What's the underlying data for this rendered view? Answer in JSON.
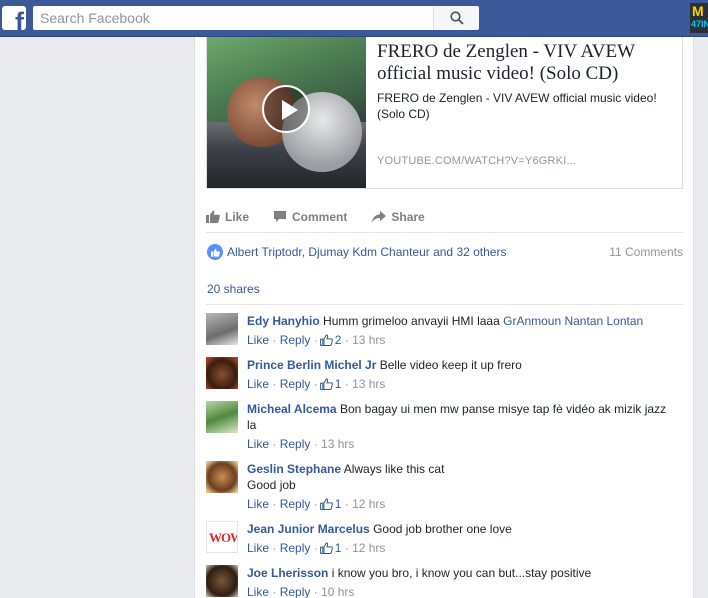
{
  "topbar": {
    "logo_letter": "f",
    "search_placeholder": "Search Facebook",
    "badge_text": "M",
    "badge_subtext": "47IN"
  },
  "link_preview": {
    "title": "FRERO de Zenglen - VIV AVEW official music video! (Solo CD)",
    "description": "FRERO de Zenglen - VIV AVEW official music video! (Solo CD)",
    "domain": "YOUTUBE.COM/WATCH?V=Y6GRKI..."
  },
  "actions": {
    "like": "Like",
    "comment": "Comment",
    "share": "Share"
  },
  "reactions": {
    "names": "Albert Triptodr, Djumay Kdm Chanteur and 32 others",
    "comments_count": "11 Comments"
  },
  "shares": "20 shares",
  "comments": [
    {
      "name": "Edy Hanyhio",
      "text": "Humm grimeloo anvayii HMI laaa",
      "mention": "GrAnmoun Nantan Lontan",
      "like": "Like",
      "reply": "Reply",
      "likes": "2",
      "time": "13 hrs"
    },
    {
      "name": "Prince Berlin Michel Jr",
      "text": "Belle video keep it up frero",
      "like": "Like",
      "reply": "Reply",
      "likes": "1",
      "time": "13 hrs"
    },
    {
      "name": "Micheal Alcema",
      "text": "Bon bagay ui men mw panse misye tap fè vidéo ak mizik jazz la",
      "like": "Like",
      "reply": "Reply",
      "time": "13 hrs"
    },
    {
      "name": "Geslin Stephane",
      "text": "Always like this cat",
      "text2": "Good job",
      "like": "Like",
      "reply": "Reply",
      "likes": "1",
      "time": "12 hrs"
    },
    {
      "name": "Jean Junior Marcelus",
      "text": "Good job brother one love",
      "avatar_text": "WOW",
      "like": "Like",
      "reply": "Reply",
      "likes": "1",
      "time": "12 hrs"
    },
    {
      "name": "Joe Lherisson",
      "text": "i know you bro, i know you can but...stay positive",
      "like": "Like",
      "reply": "Reply",
      "time": "10 hrs"
    }
  ]
}
